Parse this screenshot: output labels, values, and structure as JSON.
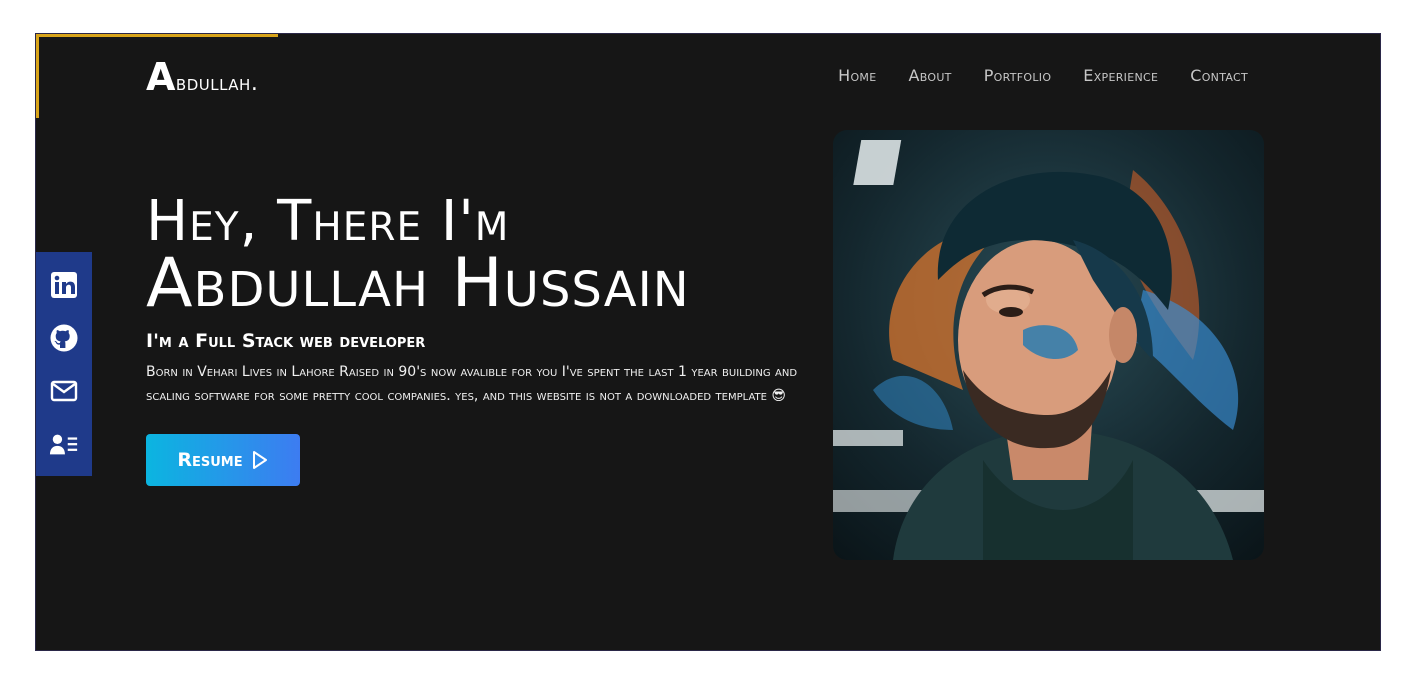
{
  "logo": {
    "initial": "A",
    "rest": "bdullah."
  },
  "nav": {
    "items": [
      {
        "label": "Home"
      },
      {
        "label": "About"
      },
      {
        "label": "Portfolio"
      },
      {
        "label": "Experience"
      },
      {
        "label": "Contact"
      }
    ]
  },
  "social": {
    "items": [
      {
        "icon": "linkedin-icon"
      },
      {
        "icon": "github-icon"
      },
      {
        "icon": "mail-icon"
      },
      {
        "icon": "contact-card-icon"
      }
    ]
  },
  "hero": {
    "greeting": "Hey, There I'm",
    "name": "Abdullah Hussain",
    "role": "I'm a Full Stack web developer",
    "bio": "Born in Vehari Lives in Lahore Raised in 90's now avalible for you I've spent the last 1 year building and scaling software for some pretty cool companies. yes, and this website is not a downloaded template 😎",
    "resume_label": "Resume"
  },
  "colors": {
    "background": "#161616",
    "accent_gold": "#d8a419",
    "social_bar": "#1f3a8a",
    "button_gradient_start": "#0bb5e0",
    "button_gradient_end": "#3d7cf1"
  }
}
